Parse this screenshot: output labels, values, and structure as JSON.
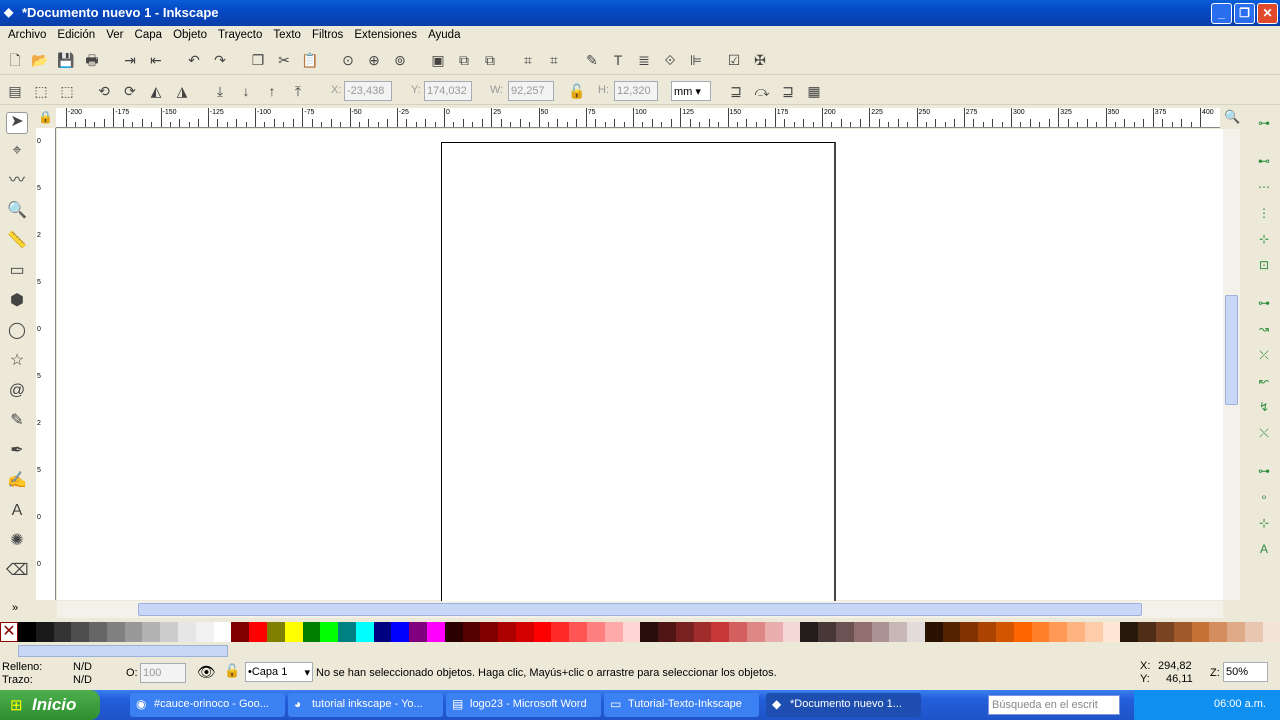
{
  "window": {
    "title": "*Documento nuevo 1 - Inkscape",
    "minimize": "_",
    "maximize": "❐",
    "close": "✕"
  },
  "menu": [
    "Archivo",
    "Edición",
    "Ver",
    "Capa",
    "Objeto",
    "Trayecto",
    "Texto",
    "Filtros",
    "Extensiones",
    "Ayuda"
  ],
  "commands_toolbar": [
    "new",
    "open",
    "save",
    "print",
    "import",
    "export",
    "undo",
    "redo",
    "duplicate",
    "cut",
    "paste",
    "zoom-selection",
    "zoom-drawing",
    "zoom-page",
    "group",
    "ungroup",
    "ungroup-2",
    "align-1",
    "align-2",
    "xml-editor",
    "text-font",
    "layers",
    "transform",
    "align-distribute",
    "preferences",
    "document-properties"
  ],
  "selector_toolbar": {
    "x_label": "X:",
    "x": "-23,438",
    "y_label": "Y:",
    "y": "174,032",
    "w_label": "W:",
    "w": "92,257",
    "h_label": "H:",
    "h": "12,320",
    "unit": "mm"
  },
  "ruler": {
    "labels": [
      "-200",
      "-175",
      "-150",
      "-125",
      "-100",
      "-75",
      "-50",
      "-25",
      "0",
      "25",
      "50",
      "75",
      "100",
      "125",
      "150",
      "175",
      "200",
      "225",
      "250",
      "275",
      "300",
      "325",
      "350",
      "375",
      "400"
    ]
  },
  "vruler": {
    "labels": [
      "0",
      "5",
      "2",
      "5",
      "0",
      "5",
      "2",
      "5",
      "0",
      "0"
    ]
  },
  "tools": [
    "selector",
    "node",
    "tweak",
    "zoom",
    "measure",
    "rectangle",
    "3d-box",
    "ellipse",
    "star",
    "spiral",
    "pencil",
    "pen",
    "calligraphy",
    "text",
    "spray",
    "eraser"
  ],
  "palette": [
    "#000000",
    "#1a1a1a",
    "#333333",
    "#4d4d4d",
    "#666666",
    "#808080",
    "#999999",
    "#b3b3b3",
    "#cccccc",
    "#e6e6e6",
    "#f2f2f2",
    "#ffffff",
    "#800000",
    "#ff0000",
    "#808000",
    "#ffff00",
    "#008000",
    "#00ff00",
    "#008080",
    "#00ffff",
    "#000080",
    "#0000ff",
    "#800080",
    "#ff00ff",
    "#2b0000",
    "#550000",
    "#800000",
    "#aa0000",
    "#d40000",
    "#ff0000",
    "#ff2a2a",
    "#ff5555",
    "#ff8080",
    "#ffaaaa",
    "#ffd5d5",
    "#280b0b",
    "#501616",
    "#782121",
    "#a02c2c",
    "#c83737",
    "#d35f5f",
    "#de8787",
    "#e9afaf",
    "#f4d7d7",
    "#241c1c",
    "#483737",
    "#6c5353",
    "#916f6f",
    "#ac9393",
    "#c8b7b7",
    "#e3dbdb",
    "#2b1100",
    "#552200",
    "#803300",
    "#aa4400",
    "#d45500",
    "#ff6600",
    "#ff7f2a",
    "#ff9955",
    "#ffb380",
    "#ffccaa",
    "#ffe6d5",
    "#28170b",
    "#502d16",
    "#784421",
    "#a05a2c",
    "#c87137",
    "#d38d5f",
    "#deaa87",
    "#e9c6af",
    "#f4e3d7"
  ],
  "status": {
    "fill_label": "Relleno:",
    "fill": "N/D",
    "stroke_label": "Trazo:",
    "stroke": "N/D",
    "opacity_label": "O:",
    "opacity": "100",
    "layer": "•Capa 1",
    "message": "No se han seleccionado objetos. Haga clic, Mayús+clic o arrastre para seleccionar los objetos.",
    "x_label": "X:",
    "x": "294,82",
    "y_label": "Y:",
    "y": "46,11",
    "zoom_label": "Z:",
    "zoom": "50%"
  },
  "taskbar": {
    "start": "Inicio",
    "tasks": [
      "#cauce-orinoco - Goo...",
      "tutorial inkscape - Yo...",
      "logo23 - Microsoft Word",
      "Tutorial-Texto-Inkscape",
      "*Documento nuevo 1..."
    ],
    "search_placeholder": "Búsqueda en el escrit",
    "clock": "06:00 a.m."
  },
  "colors": {
    "accent": "#245edb",
    "titlebar": "#0a5fd8"
  }
}
